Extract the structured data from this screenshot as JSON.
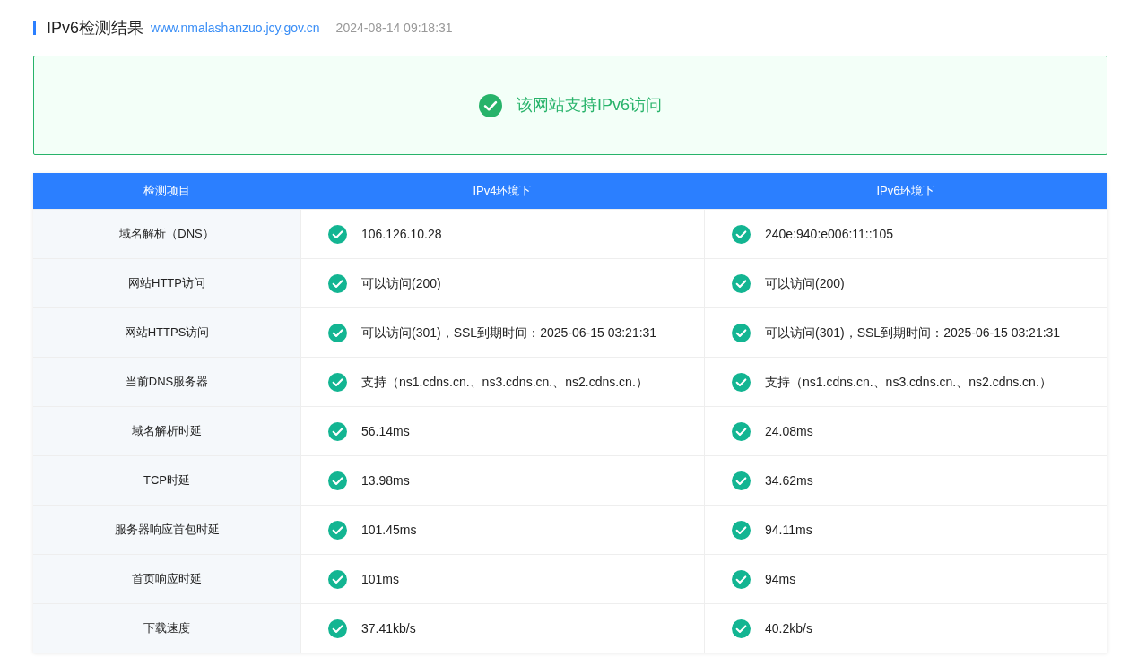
{
  "header": {
    "title": "IPv6检测结果",
    "domain": "www.nmalashanzuo.jcy.gov.cn",
    "time": "2024-08-14 09:18:31"
  },
  "banner": {
    "kind": "check",
    "text": "该网站支持IPv6访问"
  },
  "table": {
    "columns": [
      "检测项目",
      "IPv4环境下",
      "IPv6环境下"
    ],
    "rows": [
      {
        "item": "域名解析（DNS）",
        "cells": [
          {
            "kind": "check",
            "text": "106.126.10.28"
          },
          {
            "kind": "check",
            "text": "240e:940:e006:11::105"
          }
        ]
      },
      {
        "item": "网站HTTP访问",
        "cells": [
          {
            "kind": "check",
            "text": "可以访问(200)"
          },
          {
            "kind": "check",
            "text": "可以访问(200)"
          }
        ]
      },
      {
        "item": "网站HTTPS访问",
        "cells": [
          {
            "kind": "check",
            "text": "可以访问(301)，SSL到期时间：2025-06-15 03:21:31"
          },
          {
            "kind": "check",
            "text": "可以访问(301)，SSL到期时间：2025-06-15 03:21:31"
          }
        ]
      },
      {
        "item": "当前DNS服务器",
        "cells": [
          {
            "kind": "check",
            "text": "支持（ns1.cdns.cn.、ns3.cdns.cn.、ns2.cdns.cn.）"
          },
          {
            "kind": "check",
            "text": "支持（ns1.cdns.cn.、ns3.cdns.cn.、ns2.cdns.cn.）"
          }
        ]
      },
      {
        "item": "域名解析时延",
        "cells": [
          {
            "kind": "check",
            "text": "56.14ms"
          },
          {
            "kind": "check",
            "text": "24.08ms"
          }
        ]
      },
      {
        "item": "TCP时延",
        "cells": [
          {
            "kind": "check",
            "text": "13.98ms"
          },
          {
            "kind": "check",
            "text": "34.62ms"
          }
        ]
      },
      {
        "item": "服务器响应首包时延",
        "cells": [
          {
            "kind": "check",
            "text": "101.45ms"
          },
          {
            "kind": "check",
            "text": "94.11ms"
          }
        ]
      },
      {
        "item": "首页响应时延",
        "cells": [
          {
            "kind": "check",
            "text": "101ms"
          },
          {
            "kind": "check",
            "text": "94ms"
          }
        ]
      },
      {
        "item": "下载速度",
        "cells": [
          {
            "kind": "check",
            "text": "37.41kb/s"
          },
          {
            "kind": "check",
            "text": "40.2kb/s"
          }
        ]
      }
    ]
  }
}
